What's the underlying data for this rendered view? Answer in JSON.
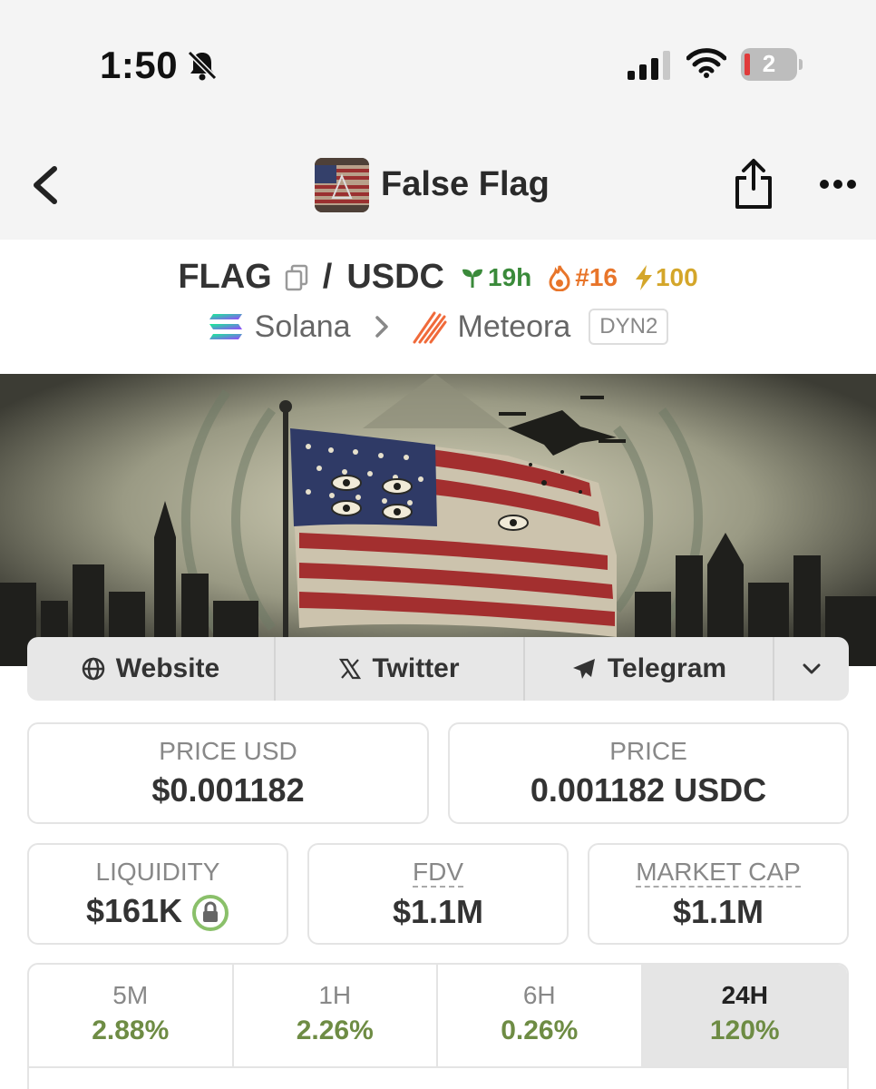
{
  "status_bar": {
    "time": "1:50",
    "battery_level": "2",
    "icons": [
      "bell-slash-icon",
      "cellular-signal-icon",
      "wifi-icon",
      "battery-icon"
    ]
  },
  "nav": {
    "title": "False Flag",
    "icons": [
      "back-chevron-icon",
      "share-icon",
      "more-icon"
    ]
  },
  "pair": {
    "base": "FLAG",
    "separator": "/",
    "quote": "USDC",
    "age": "19h",
    "rank": "#16",
    "boost": "100",
    "chain": "Solana",
    "dex": "Meteora",
    "dex_tag": "DYN2"
  },
  "links": {
    "website": "Website",
    "twitter": "Twitter",
    "telegram": "Telegram"
  },
  "stats": {
    "price_usd_label": "PRICE USD",
    "price_usd_value": "$0.001182",
    "price_label": "PRICE",
    "price_value": "0.001182 USDC",
    "liquidity_label": "LIQUIDITY",
    "liquidity_value": "$161K",
    "fdv_label": "FDV",
    "fdv_value": "$1.1M",
    "mcap_label": "MARKET CAP",
    "mcap_value": "$1.1M"
  },
  "timeframes": [
    {
      "label": "5M",
      "value": "2.88%"
    },
    {
      "label": "1H",
      "value": "2.26%"
    },
    {
      "label": "6H",
      "value": "0.26%"
    },
    {
      "label": "24H",
      "value": "120%"
    }
  ],
  "colors": {
    "positive": "#6e8c44",
    "age_green": "#3a8a3a",
    "rank_orange": "#e8752a",
    "boost_gold": "#d4a62a",
    "header_bg": "#f4f4f4"
  }
}
